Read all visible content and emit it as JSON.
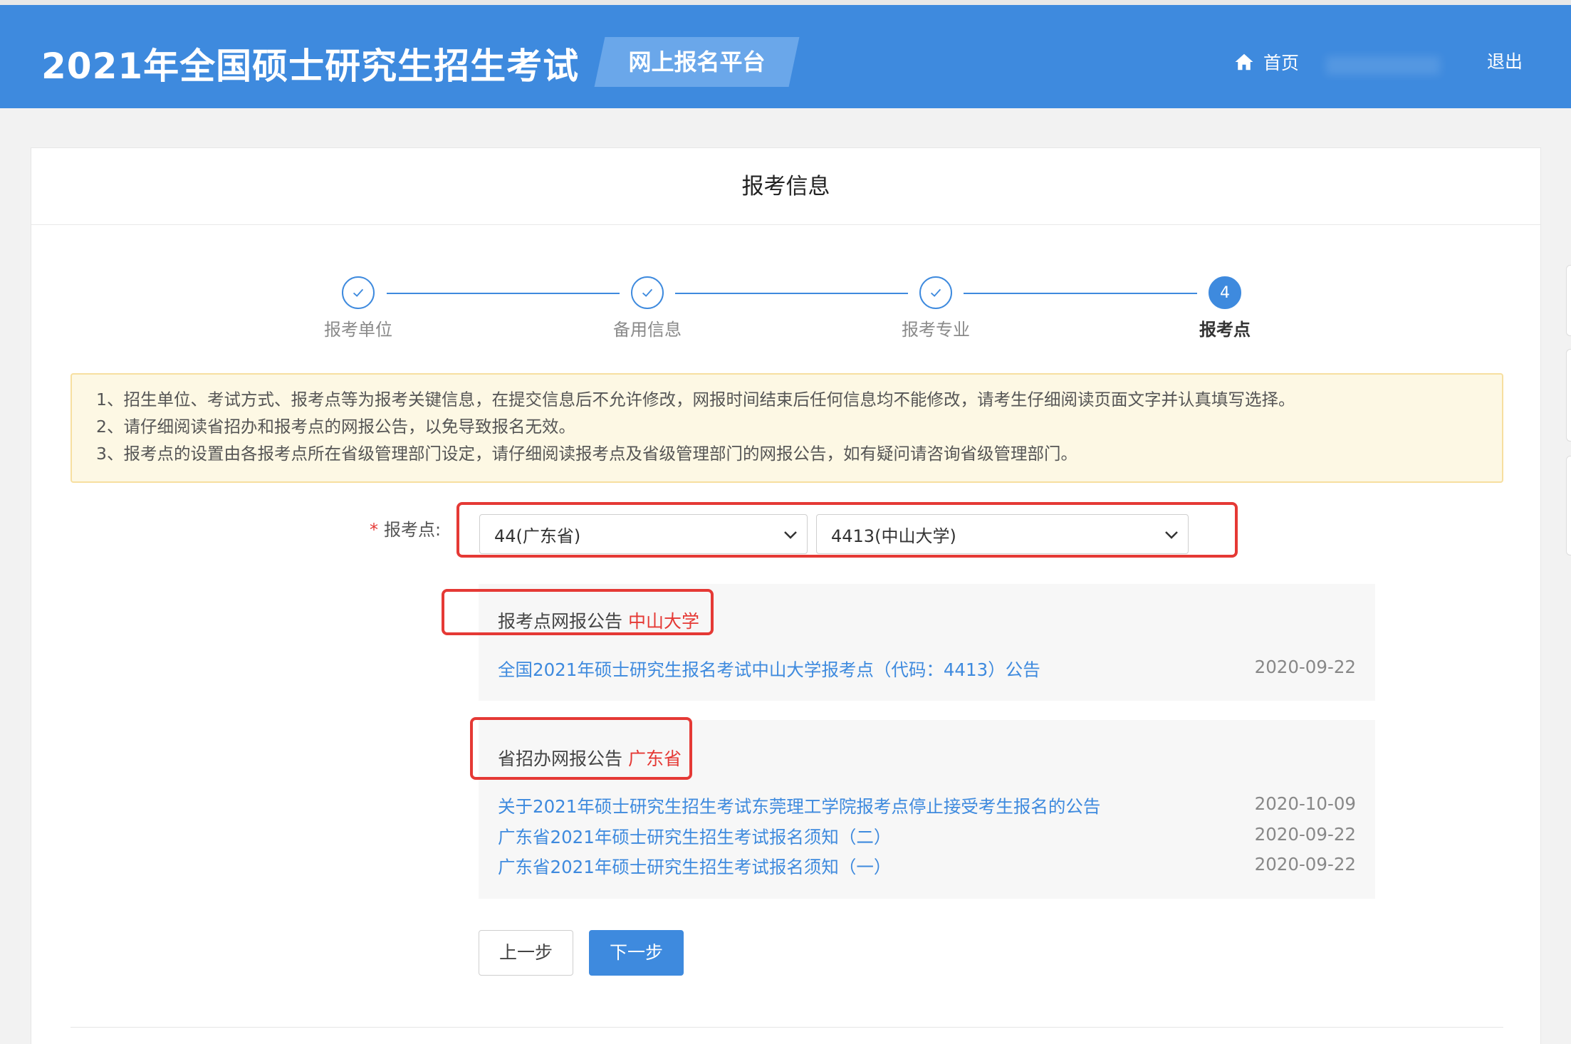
{
  "header": {
    "site_title": "2021年全国硕士研究生招生考试",
    "platform_tag": "网上报名平台",
    "home_label": "首页",
    "logout_label": "退出"
  },
  "page": {
    "title": "报考信息"
  },
  "steps": [
    {
      "label": "报考单位",
      "status": "done"
    },
    {
      "label": "备用信息",
      "status": "done"
    },
    {
      "label": "报考专业",
      "status": "done"
    },
    {
      "label": "报考点",
      "status": "active",
      "number": "4"
    }
  ],
  "notice": {
    "lines": [
      "1、招生单位、考试方式、报考点等为报考关键信息，在提交信息后不允许修改，网报时间结束后任何信息均不能修改，请考生仔细阅读页面文字并认真填写选择。",
      "2、请仔细阅读省招办和报考点的网报公告，以免导致报名无效。",
      "3、报考点的设置由各报考点所在省级管理部门设定，请仔细阅读报考点及省级管理部门的网报公告，如有疑问请咨询省级管理部门。"
    ]
  },
  "form": {
    "required_mark": "*",
    "label": "报考点:",
    "province_value": "44(广东省)",
    "separator": "-",
    "site_value": "4413(中山大学)"
  },
  "site_announcements": {
    "heading": "报考点网报公告",
    "highlight": "中山大学",
    "items": [
      {
        "title": "全国2021年硕士研究生报名考试中山大学报考点（代码：4413）公告",
        "date": "2020-09-22"
      }
    ]
  },
  "province_announcements": {
    "heading": "省招办网报公告",
    "highlight": "广东省",
    "items": [
      {
        "title": "关于2021年硕士研究生招生考试东莞理工学院报考点停止接受考生报名的公告",
        "date": "2020-10-09"
      },
      {
        "title": "广东省2021年硕士研究生招生考试报名须知（二）",
        "date": "2020-09-22"
      },
      {
        "title": "广东省2021年硕士研究生招生考试报名须知（一）",
        "date": "2020-09-22"
      }
    ]
  },
  "buttons": {
    "prev_label": "上一步",
    "next_label": "下一步"
  },
  "colors": {
    "header_blue": "#3e8ade",
    "highlight_red": "#e53935",
    "notice_bg": "#fdf8e4"
  }
}
